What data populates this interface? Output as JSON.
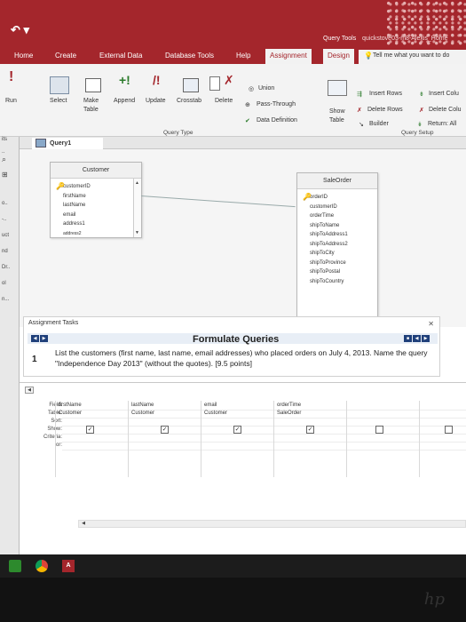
{
  "ribbon_tabs": {
    "home": "Home",
    "create": "Create",
    "external_data": "External Data",
    "database_tools": "Database Tools",
    "help": "Help",
    "assignment": "Assignment",
    "design": "Design"
  },
  "titlebar": {
    "query_tools": "Query Tools",
    "file_name": "quickstove03-m8-Alexis_Home",
    "tell_me": "Tell me what you want to do"
  },
  "ribbon": {
    "run": "Run",
    "select": "Select",
    "make_table_1": "Make",
    "make_table_2": "Table",
    "append": "Append",
    "update": "Update",
    "crosstab": "Crosstab",
    "delete": "Delete",
    "union": "Union",
    "pass_through": "Pass-Through",
    "data_definition": "Data Definition",
    "query_type_group": "Query Type",
    "show_table_1": "Show",
    "show_table_2": "Table",
    "insert_rows": "Insert Rows",
    "delete_rows": "Delete Rows",
    "builder": "Builder",
    "insert_columns": "Insert Colu",
    "delete_columns": "Delete Colu",
    "return": "Return: All",
    "query_setup_group": "Query Setup"
  },
  "left_pane": [
    "its",
    "..",
    "o..",
    "-..",
    "uct",
    "nd",
    "Dr..",
    "ol",
    "n..."
  ],
  "document": {
    "tab_label": "Query1"
  },
  "tables": {
    "customer": {
      "title": "Customer",
      "fields": [
        "customerID",
        "firstName",
        "lastName",
        "email",
        "address1",
        "address2"
      ]
    },
    "saleorder": {
      "title": "SaleOrder",
      "fields": [
        "orderID",
        "customerID",
        "orderTime",
        "shipToName",
        "shipToAddress1",
        "shipToAddress2",
        "shipToCity",
        "shipToProvince",
        "shipToPostal",
        "shipToCountry"
      ]
    }
  },
  "assignment": {
    "header": "Assignment Tasks",
    "title": "Formulate Queries",
    "number": "1",
    "task_text": "List the customers (first name, last name, email addresses) who placed orders on July 4, 2013. Name the query \"Independence Day 2013\" (without the quotes). [9.5 points]"
  },
  "grid": {
    "row_labels": [
      "Field:",
      "Table:",
      "Sort:",
      "Show:",
      "Criteria:",
      "or:"
    ],
    "columns": [
      {
        "field": "firstName",
        "table": "Customer",
        "show": true
      },
      {
        "field": "lastName",
        "table": "Customer",
        "show": true
      },
      {
        "field": "email",
        "table": "Customer",
        "show": true
      },
      {
        "field": "orderTime",
        "table": "SaleOrder",
        "show": true
      },
      {
        "field": "",
        "table": "",
        "show": false
      },
      {
        "field": "",
        "table": "",
        "show": false
      }
    ]
  },
  "colors": {
    "accent": "#a4262c",
    "ribbon_bg": "#f3f3f3",
    "nav_button": "#1f3f7a"
  }
}
